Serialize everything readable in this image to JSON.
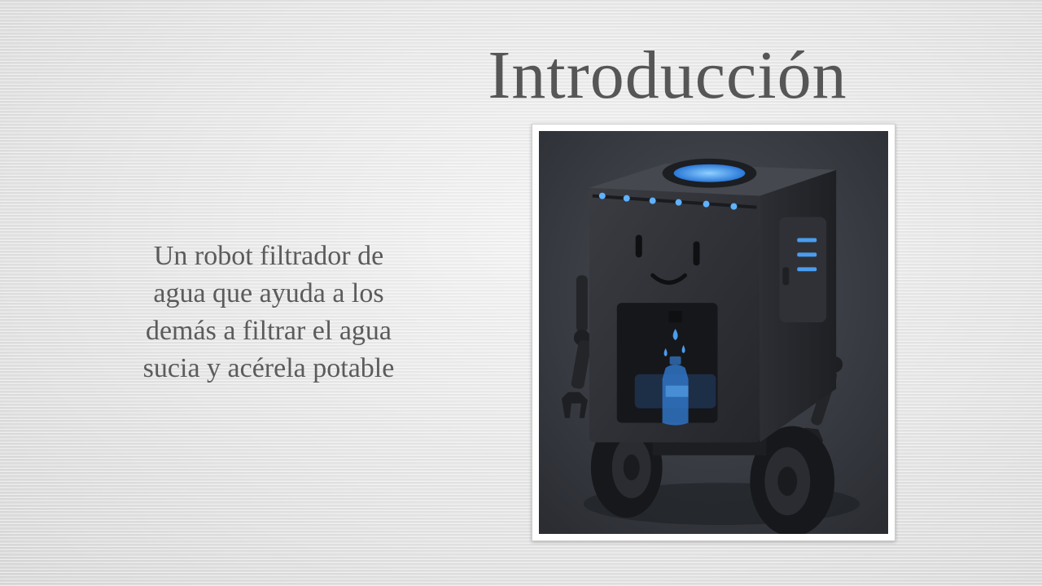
{
  "slide": {
    "title": "Introducción",
    "body_lines": [
      "Un robot filtrador de",
      "agua que ayuda a los",
      "demás a filtrar el agua",
      "sucia y acérela potable"
    ],
    "image": {
      "alt": "robot-water-filter-illustration",
      "accent_color": "#4a9df0",
      "body_color": "#2a2c31",
      "background_color": "#3d4047"
    }
  }
}
